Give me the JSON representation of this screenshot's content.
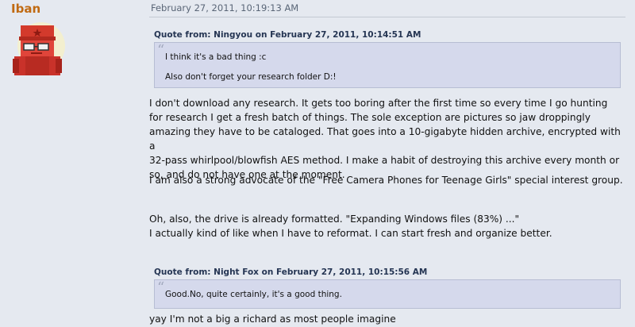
{
  "poster": {
    "username": "Iban",
    "avatar_icon": "red-robot-avatar-icon"
  },
  "post": {
    "date": "February 27, 2011, 10:19:13 AM",
    "quote1": {
      "header": "Quote from: Ningyou on February 27, 2011, 10:14:51 AM",
      "line1": "I think it's a bad thing :c",
      "line2": "Also don't forget your research folder D:!"
    },
    "para1_line1": "I don't download any research. It gets too boring after the first time so every time I go hunting",
    "para1_line2": "for research I get a fresh batch of things. The sole exception are pictures so jaw droppingly",
    "para1_line3": "amazing they have to be cataloged. That goes into a 10-gigabyte hidden archive, encrypted with a",
    "para1_line4": "32-pass whirlpool/blowfish AES method. I make a habit of destroying this archive every month or",
    "para1_line5": "so, and do not have one at the moment.",
    "para2": "I am also a strong advocate of the \"Free Camera Phones for Teenage Girls\" special interest group.",
    "para3_line1": "Oh, also, the drive is already formatted. \"Expanding Windows files (83%) ...\"",
    "para3_line2": "I actually kind of like when I have to reformat. I can start fresh and organize better.",
    "quote2": {
      "header": "Quote from: Night Fox on February 27, 2011, 10:15:56 AM",
      "line1": "Good.No, quite certainly, it's a good thing."
    },
    "para4": "yay I'm not a big a richard as most people imagine"
  },
  "colors": {
    "background": "#e5e9f0",
    "quote_background": "#d5d9ec",
    "username": "#c06a12",
    "quote_header": "#253553"
  }
}
